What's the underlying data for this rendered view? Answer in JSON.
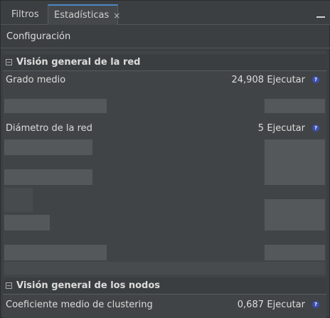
{
  "tabs": [
    {
      "label": "Filtros",
      "active": false
    },
    {
      "label": "Estadísticas",
      "active": true,
      "close": "×"
    }
  ],
  "toolbar": {
    "config_label": "Configuración"
  },
  "sections": {
    "network": {
      "title": "Visión general de la red",
      "rows": [
        {
          "label": "Grado medio",
          "value": "24,908",
          "action": "Ejecutar",
          "help": "?"
        },
        {
          "label": "Diámetro de la red",
          "value": "5",
          "action": "Ejecutar",
          "help": "?"
        }
      ]
    },
    "nodes": {
      "title": "Visión general de los nodos",
      "rows": [
        {
          "label": "Coeficiente medio de clustering",
          "value": "0,687",
          "action": "Ejecutar",
          "help": "?"
        }
      ]
    }
  },
  "colors": {
    "background": "#3c3f41",
    "accent": "#4a88c7",
    "help_icon": "#3b4fb0"
  }
}
